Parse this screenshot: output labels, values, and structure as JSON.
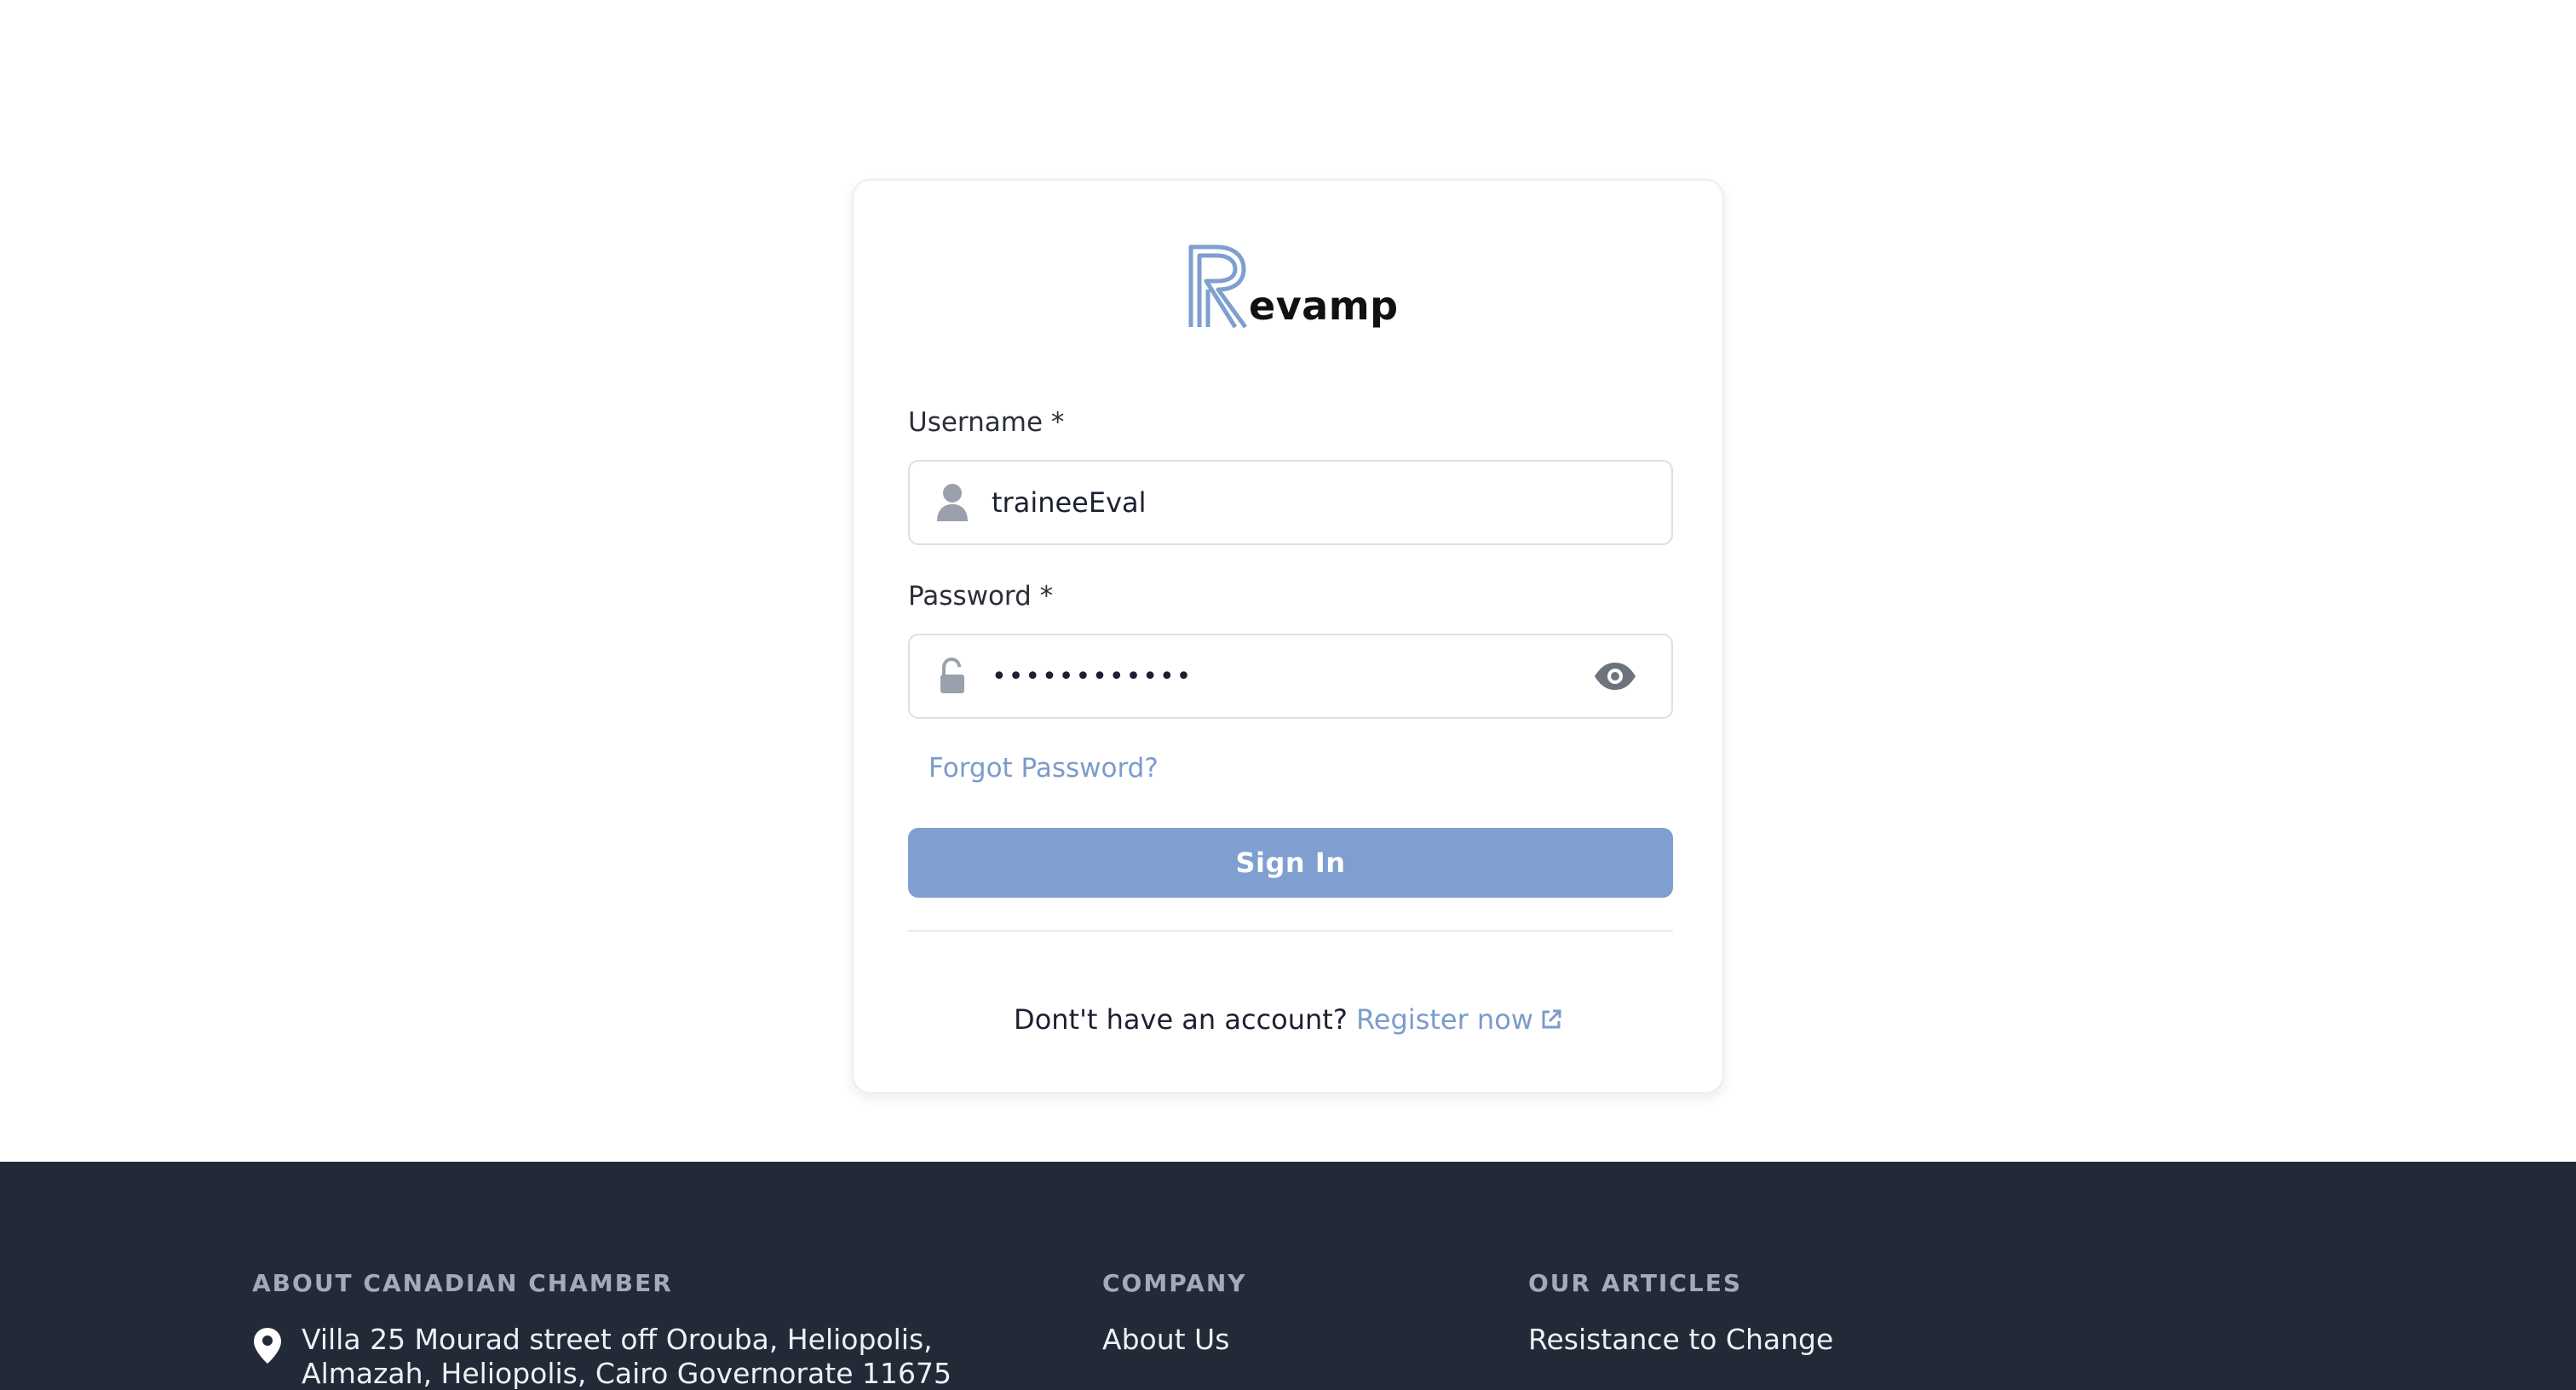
{
  "brand": {
    "logo_letter": "R",
    "logo_text": "evamp",
    "accent_color": "#7e9fcf"
  },
  "login": {
    "username_label": "Username *",
    "username_value": "traineeEval",
    "username_icon": "user-icon",
    "password_label": "Password *",
    "password_value": "••••••••••••",
    "password_icon": "lock-open-icon",
    "toggle_icon": "eye-icon",
    "forgot_password": "Forgot Password?",
    "signin_label": "Sign In",
    "register_prompt": "Dont't have an account?",
    "register_link": "Register now",
    "register_icon": "external-link-icon"
  },
  "footer": {
    "background": "#222937",
    "about": {
      "heading": "ABOUT CANADIAN CHAMBER",
      "address": "Villa 25 Mourad street off Orouba, Heliopolis, Almazah, Heliopolis, Cairo Governorate 11675",
      "address_icon": "map-pin-icon"
    },
    "company": {
      "heading": "COMPANY",
      "items": [
        "About Us"
      ]
    },
    "articles": {
      "heading": "OUR ARTICLES",
      "items": [
        "Resistance to Change"
      ]
    }
  }
}
